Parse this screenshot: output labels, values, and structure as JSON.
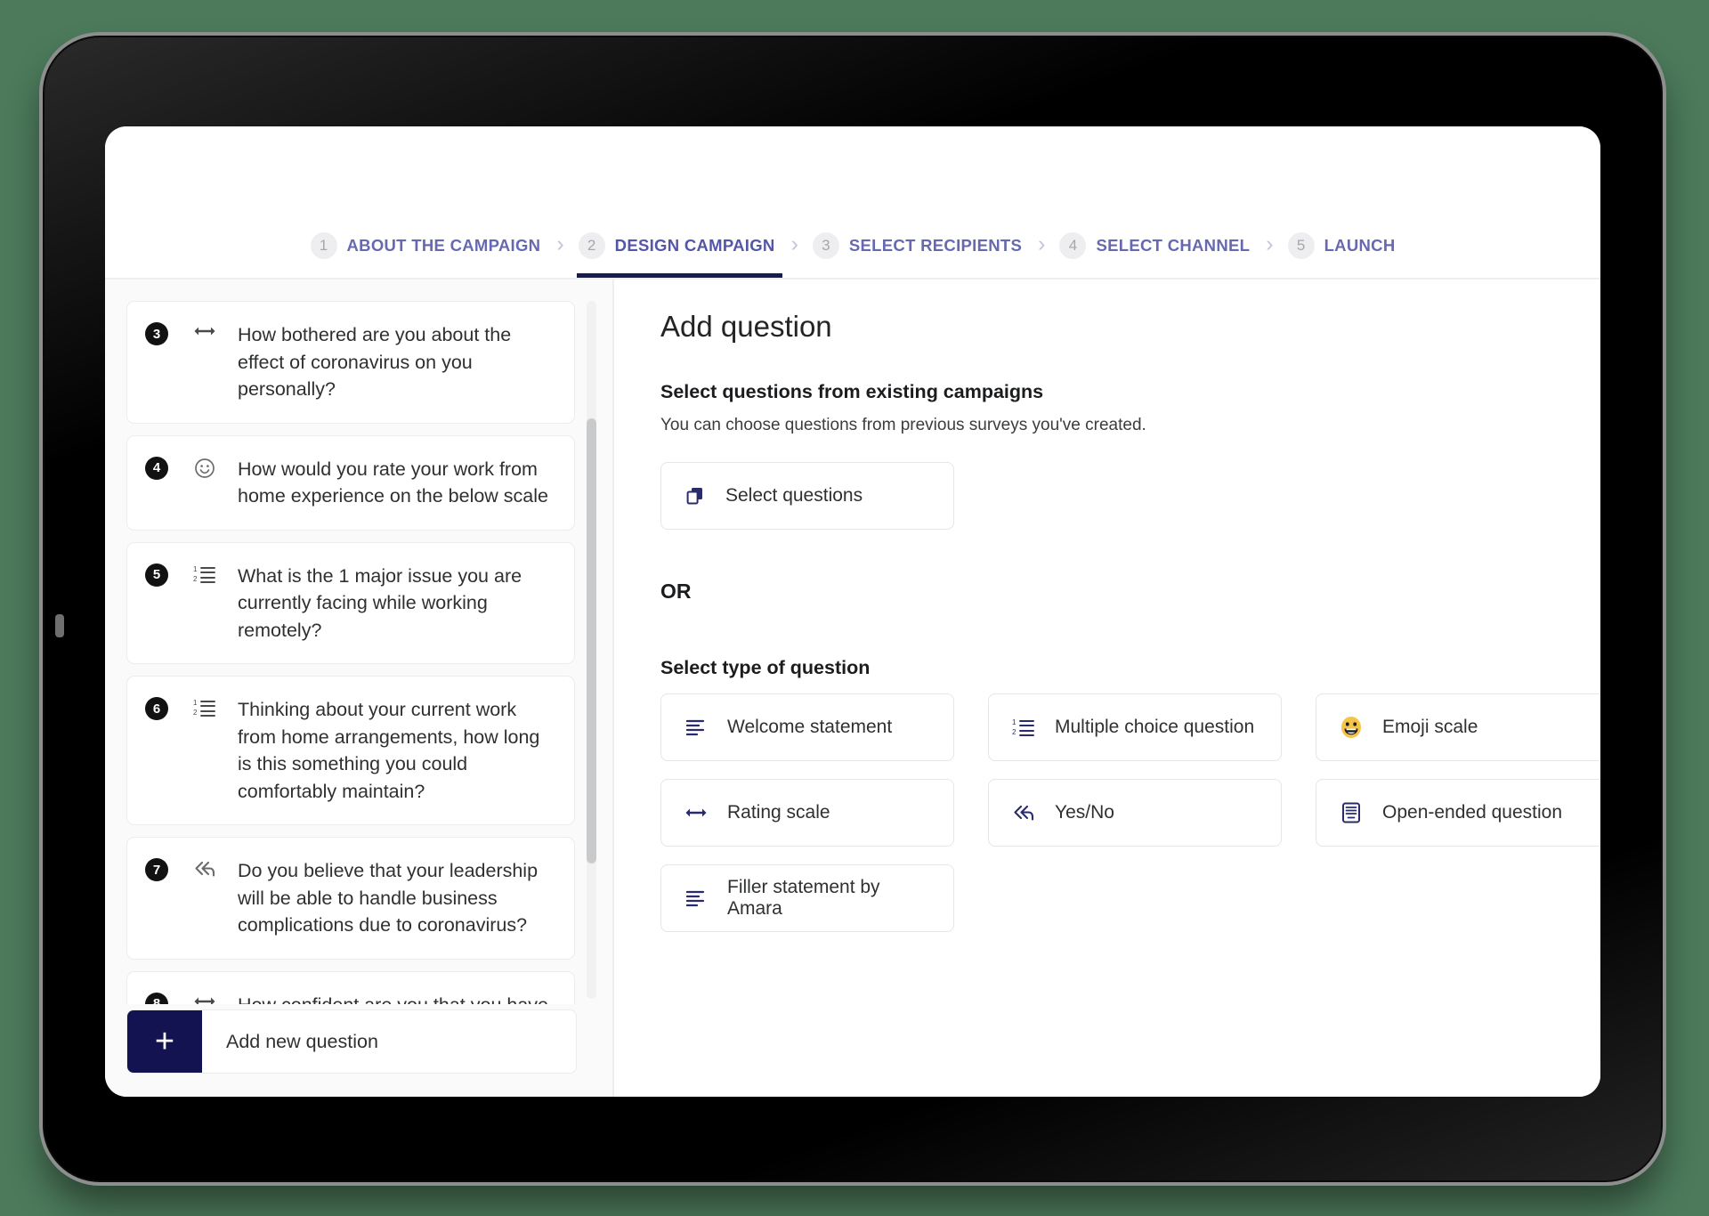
{
  "colors": {
    "background": "#4c7a5b",
    "accent_navy": "#141352",
    "step_active_underline": "#191a52",
    "step_label": "#6769b0",
    "icon_navy": "#2a2b6b",
    "emoji_yellow": "#f6c445"
  },
  "stepper": {
    "steps": [
      {
        "num": "1",
        "label": "ABOUT THE CAMPAIGN",
        "active": false
      },
      {
        "num": "2",
        "label": "DESIGN CAMPAIGN",
        "active": true
      },
      {
        "num": "3",
        "label": "SELECT RECIPIENTS",
        "active": false
      },
      {
        "num": "4",
        "label": "SELECT CHANNEL",
        "active": false
      },
      {
        "num": "5",
        "label": "LAUNCH",
        "active": false
      }
    ],
    "separator": "›"
  },
  "left_panel": {
    "questions": [
      {
        "num": "3",
        "icon": "rating-scale-icon",
        "text": "How bothered are you about the effect of coronavirus on you personally?"
      },
      {
        "num": "4",
        "icon": "emoji-scale-icon",
        "text": "How would you rate your work from home experience on the below scale"
      },
      {
        "num": "5",
        "icon": "numbered-list-icon",
        "text": "What is the 1 major issue you are currently facing while working remotely?"
      },
      {
        "num": "6",
        "icon": "numbered-list-icon",
        "text": "Thinking about your current work from home arrangements, how long is this something you could comfortably maintain?"
      },
      {
        "num": "7",
        "icon": "yes-no-icon",
        "text": "Do you believe that your leadership will be able to handle business complications due to coronavirus?"
      },
      {
        "num": "8",
        "icon": "rating-scale-icon",
        "text": "How confident are you that you have the right resources and benefit from your company to help support you through this period?"
      }
    ],
    "add_new_question_label": "Add new question",
    "add_new_question_plus": "+"
  },
  "right_panel": {
    "title": "Add question",
    "existing": {
      "heading": "Select questions from existing campaigns",
      "subtext": "You can choose questions from previous surveys you've created.",
      "button_label": "Select questions",
      "button_icon": "copy-icon"
    },
    "or_label": "OR",
    "type_section": {
      "heading": "Select type of question",
      "types": [
        {
          "label": "Welcome statement",
          "icon": "text-lines-icon",
          "row": "full"
        },
        {
          "label": "Multiple choice question",
          "icon": "numbered-list-icon",
          "row": "grid"
        },
        {
          "label": "Emoji scale",
          "icon": "emoji-face-icon",
          "row": "grid"
        },
        {
          "label": "Rating scale",
          "icon": "rating-scale-icon",
          "row": "grid"
        },
        {
          "label": "Yes/No",
          "icon": "yes-no-icon",
          "row": "grid"
        },
        {
          "label": "Open-ended question",
          "icon": "keyboard-icon",
          "row": "grid"
        },
        {
          "label": "Filler statement by Amara",
          "icon": "text-lines-icon",
          "row": "grid"
        }
      ]
    }
  }
}
